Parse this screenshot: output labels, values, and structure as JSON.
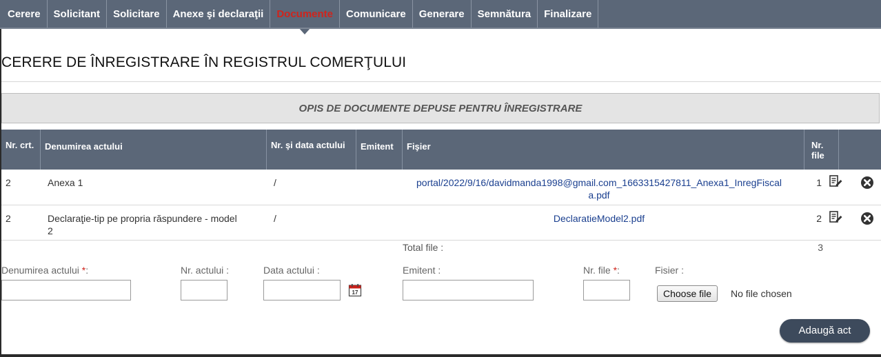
{
  "nav": {
    "tabs": [
      {
        "label": "Cerere"
      },
      {
        "label": "Solicitant"
      },
      {
        "label": "Solicitare"
      },
      {
        "label": "Anexe şi declaraţii"
      },
      {
        "label": "Documente",
        "active": true
      },
      {
        "label": "Comunicare"
      },
      {
        "label": "Generare"
      },
      {
        "label": "Semnătura"
      },
      {
        "label": "Finalizare"
      }
    ]
  },
  "page": {
    "title": "CERERE DE ÎNREGISTRARE ÎN REGISTRUL COMERŢULUI",
    "section_title": "OPIS DE DOCUMENTE DEPUSE PENTRU ÎNREGISTRARE"
  },
  "table": {
    "headers": {
      "nr_crt": "Nr. crt.",
      "denumire": "Denumirea actului",
      "nr_data": "Nr. şi data actului",
      "emitent": "Emitent",
      "fisier": "Fişier",
      "nr_file": "Nr. file"
    },
    "rows": [
      {
        "nr_crt": "2",
        "denumire": "Anexa 1",
        "nr_data": "/",
        "emitent": "",
        "fisier": "portal/2022/9/16/davidmanda1998@gmail.com_1663315427811_Anexa1_InregFiscala.pdf",
        "nr_file": "1"
      },
      {
        "nr_crt": "2",
        "denumire": "Declaraţie-tip pe propria răspundere - model 2",
        "nr_data": "/",
        "emitent": "",
        "fisier": "DeclaratieModel2.pdf",
        "nr_file": "2"
      }
    ],
    "total_label": "Total file :",
    "total_value": "3"
  },
  "form": {
    "denumire_label": "Denumirea actului",
    "nr_actului_label": "Nr. actului :",
    "data_actului_label": "Data actului :",
    "emitent_label": "Emitent :",
    "nr_file_label": "Nr. file",
    "fisier_label": "Fisier :",
    "required_mark": "*",
    "label_colon": ":",
    "choose_file": "Choose file",
    "no_file": "No file chosen",
    "calendar_day": "17",
    "add_button": "Adaugă act"
  },
  "colors": {
    "nav_bg": "#5b6778",
    "active_tab_text": "#d0241c",
    "link": "#1a3f8f",
    "add_button_bg": "#3d4a5c"
  }
}
